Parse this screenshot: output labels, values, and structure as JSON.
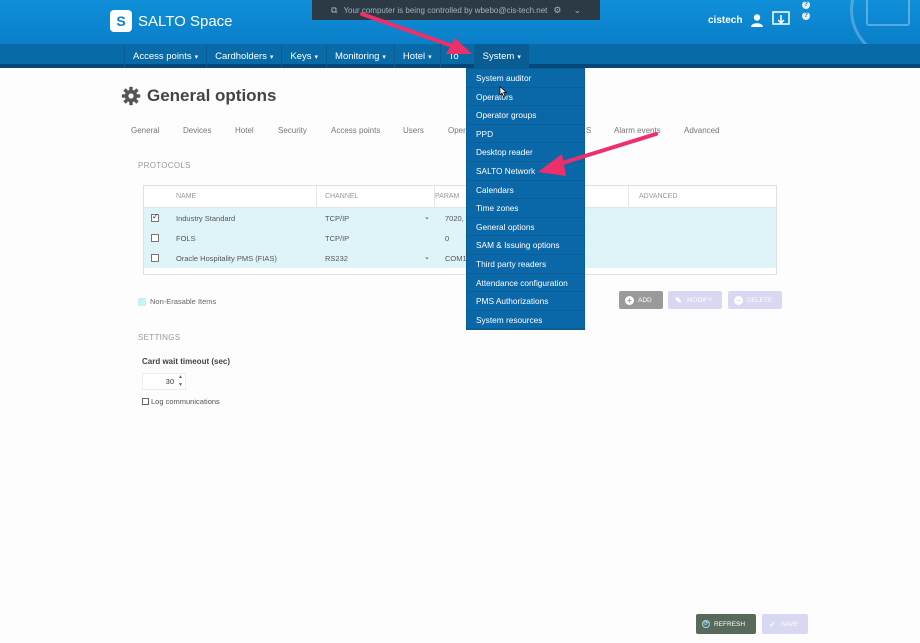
{
  "app": {
    "name": "SALTO Space",
    "logo_letter": "S"
  },
  "remote_banner": "Your computer is being controlled by wbebo@cis-tech.net",
  "user": {
    "name": "cistech"
  },
  "nav": {
    "items": [
      {
        "label": "Access points"
      },
      {
        "label": "Cardholders"
      },
      {
        "label": "Keys"
      },
      {
        "label": "Monitoring"
      },
      {
        "label": "Hotel"
      },
      {
        "label": "To"
      },
      {
        "label": "System"
      }
    ],
    "caret": "▾",
    "active": "System"
  },
  "page": {
    "title": "General options"
  },
  "tabs": [
    "General",
    "Devices",
    "Hotel",
    "Security",
    "Access points",
    "Users",
    "Oper",
    "S",
    "Alarm events",
    "Advanced"
  ],
  "protocols": {
    "section_label": "PROTOCOLS",
    "columns": [
      "NAME",
      "CHANNEL",
      "PARAM",
      "ADVANCED"
    ],
    "rows": [
      {
        "checked": true,
        "name": "Industry Standard",
        "channel": "TCP/IP",
        "param": "7020,"
      },
      {
        "checked": false,
        "name": "FOLS",
        "channel": "TCP/IP",
        "param": "0"
      },
      {
        "checked": false,
        "name": "Oracle Hospitality PMS (FIAS)",
        "channel": "RS232",
        "param": "COM1,"
      }
    ],
    "legend": "Non-Erasable Items",
    "buttons": {
      "add": "ADD",
      "modify": "MODIFY",
      "delete": "DELETE"
    }
  },
  "settings": {
    "section_label": "SETTINGS",
    "card_wait_label": "Card wait timeout (sec)",
    "card_wait_value": "30",
    "log_label": "Log communications"
  },
  "system_menu": {
    "items": [
      "System auditor",
      "Operators",
      "Operator groups",
      "PPD",
      "Desktop reader",
      "SALTO Network",
      "Calendars",
      "Time zones",
      "General options",
      "SAM & Issuing options",
      "Third party readers",
      "Attendance configuration",
      "PMS Authorizations",
      "System resources"
    ]
  },
  "footer": {
    "refresh": "REFRESH",
    "save": "SAVE"
  },
  "colors": {
    "header": "#0a7fc9",
    "nav": "#086aa6",
    "menu": "#0b68a8",
    "row_highlight": "#dff4f9",
    "arrow": "#ee2f6a"
  }
}
